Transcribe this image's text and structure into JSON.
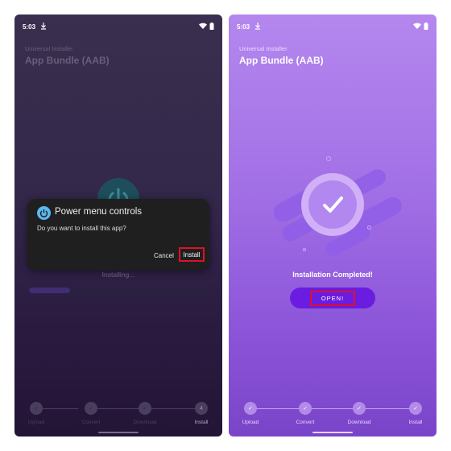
{
  "left_screen": {
    "status_time": "5:03",
    "app_subtitle": "Universal Installer",
    "app_title": "App Bundle (AAB)",
    "dialog": {
      "title": "Power menu controls",
      "message": "Do you want to install this app?",
      "cancel_label": "Cancel",
      "install_label": "Install"
    },
    "status_text": "Installing...",
    "progress_fraction": 0.23,
    "steps": [
      {
        "label": "Upload",
        "marker": "✓"
      },
      {
        "label": "Convert",
        "marker": "✓"
      },
      {
        "label": "Download",
        "marker": "✓"
      },
      {
        "label": "Install",
        "marker": "4"
      }
    ]
  },
  "right_screen": {
    "status_time": "5:03",
    "app_subtitle": "Universal Installer",
    "app_title": "App Bundle (AAB)",
    "status_text": "Installation Completed!",
    "open_label": "OPEN!",
    "steps": [
      {
        "label": "Upload",
        "marker": "✓"
      },
      {
        "label": "Convert",
        "marker": "✓"
      },
      {
        "label": "Download",
        "marker": "✓"
      },
      {
        "label": "Install",
        "marker": "✓"
      }
    ]
  },
  "colors": {
    "highlight_border": "#e0102a",
    "open_button": "#6a1de0",
    "dialog_background": "#1f1f1f",
    "app_icon": "#5bb7ef"
  },
  "icons": [
    "download-icon",
    "wifi-icon",
    "battery-icon",
    "power-icon",
    "app-icon",
    "checkmark-icon"
  ]
}
